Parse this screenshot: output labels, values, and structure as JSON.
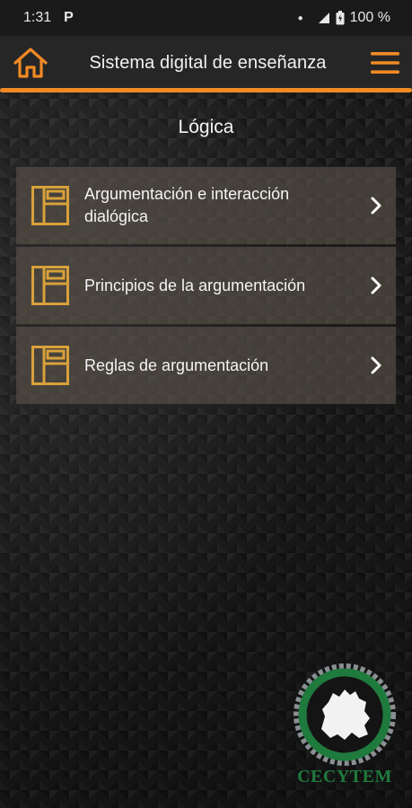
{
  "status_bar": {
    "time": "1:31",
    "p_icon": "P",
    "battery": "100 %",
    "icons": [
      "notification-dot",
      "signal-icon",
      "battery-icon"
    ]
  },
  "app_bar": {
    "title": "Sistema digital de enseñanza",
    "home_icon": "home-icon",
    "menu_icon": "hamburger-menu-icon",
    "accent_color": "#f08a24"
  },
  "section": {
    "title": "Lógica"
  },
  "menu_items": [
    {
      "label": "Argumentación e interacción dialógica",
      "icon": "layout-icon"
    },
    {
      "label": "Principios de la argumentación",
      "icon": "layout-icon"
    },
    {
      "label": "Reglas de argumentación",
      "icon": "layout-icon"
    }
  ],
  "logo": {
    "text": "CECYTEM",
    "color": "#1f7a3d"
  }
}
